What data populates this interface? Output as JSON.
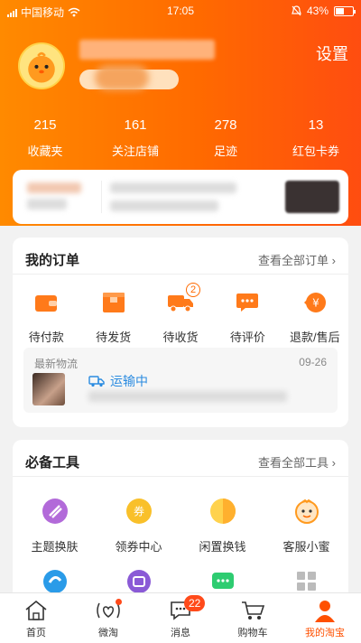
{
  "statusbar": {
    "carrier": "中国移动",
    "time": "17:05",
    "battery": "43%"
  },
  "profile": {
    "settings": "设置"
  },
  "stats": [
    {
      "num": "215",
      "label": "收藏夹"
    },
    {
      "num": "161",
      "label": "关注店铺"
    },
    {
      "num": "278",
      "label": "足迹"
    },
    {
      "num": "13",
      "label": "红包卡券"
    }
  ],
  "orders": {
    "title": "我的订单",
    "view_all": "查看全部订单 ›",
    "items": [
      {
        "label": "待付款",
        "icon": "wallet-icon"
      },
      {
        "label": "待发货",
        "icon": "package-icon"
      },
      {
        "label": "待收货",
        "icon": "delivery-truck-icon",
        "badge": "2"
      },
      {
        "label": "待评价",
        "icon": "comment-icon"
      },
      {
        "label": "退款/售后",
        "icon": "refund-icon"
      }
    ],
    "logistics": {
      "title": "最新物流",
      "date": "09-26",
      "status": "运输中"
    }
  },
  "tools": {
    "title": "必备工具",
    "view_all": "查看全部工具 ›",
    "row1": [
      {
        "label": "主题换肤",
        "icon": "theme-icon"
      },
      {
        "label": "领券中心",
        "icon": "coupon-icon"
      },
      {
        "label": "闲置换钱",
        "icon": "idle-exchange-icon"
      },
      {
        "label": "客服小蜜",
        "icon": "customer-service-icon"
      }
    ]
  },
  "tabbar": [
    {
      "label": "首页",
      "icon": "home-icon"
    },
    {
      "label": "微淘",
      "icon": "weitao-icon",
      "dot": true
    },
    {
      "label": "消息",
      "icon": "message-icon",
      "badge": "22"
    },
    {
      "label": "购物车",
      "icon": "cart-icon"
    },
    {
      "label": "我的淘宝",
      "icon": "my-taobao-icon",
      "active": true
    }
  ],
  "colors": {
    "accent": "#ff5000",
    "header_start": "#ff8a00",
    "header_end": "#ff4d10",
    "link_blue": "#2a8be0"
  }
}
